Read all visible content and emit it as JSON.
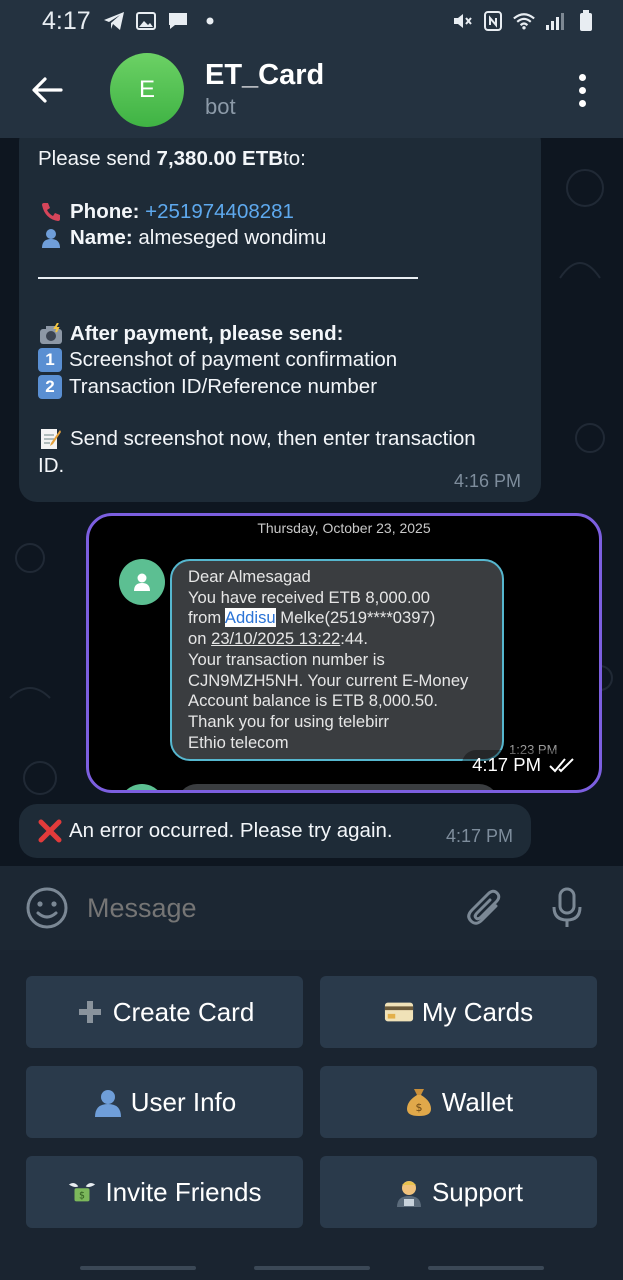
{
  "status_bar": {
    "time": "4:17"
  },
  "header": {
    "avatar_letter": "E",
    "title": "ET_Card",
    "subtitle": "bot"
  },
  "messages": {
    "payment": {
      "intro_prefix": "Please send ",
      "amount": "7,380.00 ETB",
      "intro_suffix": " to:",
      "phone_label": "Phone:",
      "phone_value": "+251974408281",
      "name_label": "Name:",
      "name_value": "almeseged wondimu",
      "after_title": "After payment, please send:",
      "step1": "Screenshot of payment confirmation",
      "step2": "Transaction ID/Reference number",
      "send_line1": "Send screenshot now, then enter transaction",
      "send_line2": "ID.",
      "time": "4:16 PM"
    },
    "image": {
      "date_header": "Thursday, October 23, 2025",
      "sms_lines": [
        "Dear Almesagad",
        "You have received ETB 8,000.00",
        "from",
        "Addisu",
        "Melke(2519****0397)",
        "on",
        "23/10/2025 13:22",
        ":44.",
        "Your transaction number is",
        "CJN9MZH5NH. Your current E-Money",
        "Account balance is ETB 8,000.50.",
        "Thank you for using telebirr",
        "Ethio telecom"
      ],
      "sms_time": "1:23 PM",
      "time": "4:17 PM"
    },
    "error": {
      "text": "An error occurred. Please try again.",
      "time": "4:17 PM"
    }
  },
  "input": {
    "placeholder": "Message"
  },
  "keyboard": {
    "create_card": "Create Card",
    "my_cards": "My Cards",
    "user_info": "User Info",
    "wallet": "Wallet",
    "invite_friends": "Invite Friends",
    "support": "Support"
  },
  "colors": {
    "header_bg": "#243240",
    "bubble_in": "#1e2b37",
    "link": "#5ea9ee",
    "image_border": "#7c5fe0",
    "keyboard_button": "#2a3a4b"
  },
  "icons": {
    "status": [
      "telegram-icon",
      "gallery-icon",
      "chat-icon",
      "mute-icon",
      "nfc-icon",
      "wifi-icon",
      "signal-icon",
      "battery-icon"
    ],
    "header": [
      "back-arrow-icon",
      "more-vert-icon"
    ],
    "input": [
      "emoji-icon",
      "attach-icon",
      "mic-icon"
    ]
  }
}
